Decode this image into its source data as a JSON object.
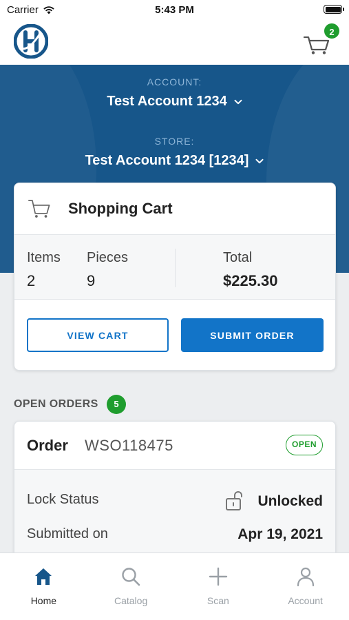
{
  "status_bar": {
    "carrier": "Carrier",
    "time": "5:43 PM"
  },
  "header": {
    "logo_icon": "brand-logo-icon",
    "cart_icon": "cart-icon",
    "cart_count": "2"
  },
  "selectors": {
    "account_label": "ACCOUNT:",
    "account_value": "Test Account 1234",
    "store_label": "STORE:",
    "store_value": "Test Account 1234 [1234]"
  },
  "cart_card": {
    "icon": "cart-icon",
    "title": "Shopping Cart",
    "items_label": "Items",
    "items_value": "2",
    "pieces_label": "Pieces",
    "pieces_value": "9",
    "total_label": "Total",
    "total_value": "$225.30",
    "view_cart_label": "VIEW CART",
    "submit_order_label": "SUBMIT ORDER"
  },
  "open_orders": {
    "title": "OPEN ORDERS",
    "count": "5",
    "orders": [
      {
        "order_word": "Order",
        "order_number": "WSO118475",
        "status": "OPEN",
        "lock_label": "Lock Status",
        "lock_value": "Unlocked",
        "submitted_label": "Submitted on",
        "submitted_value": "Apr 19, 2021"
      }
    ]
  },
  "tabbar": {
    "tabs": [
      {
        "label": "Home",
        "icon": "home-icon",
        "active": true
      },
      {
        "label": "Catalog",
        "icon": "search-icon",
        "active": false
      },
      {
        "label": "Scan",
        "icon": "plus-icon",
        "active": false
      },
      {
        "label": "Account",
        "icon": "person-icon",
        "active": false
      }
    ]
  },
  "colors": {
    "brand_blue": "#17568a",
    "accent_blue": "#1274c8",
    "badge_green": "#1f9d2e"
  }
}
